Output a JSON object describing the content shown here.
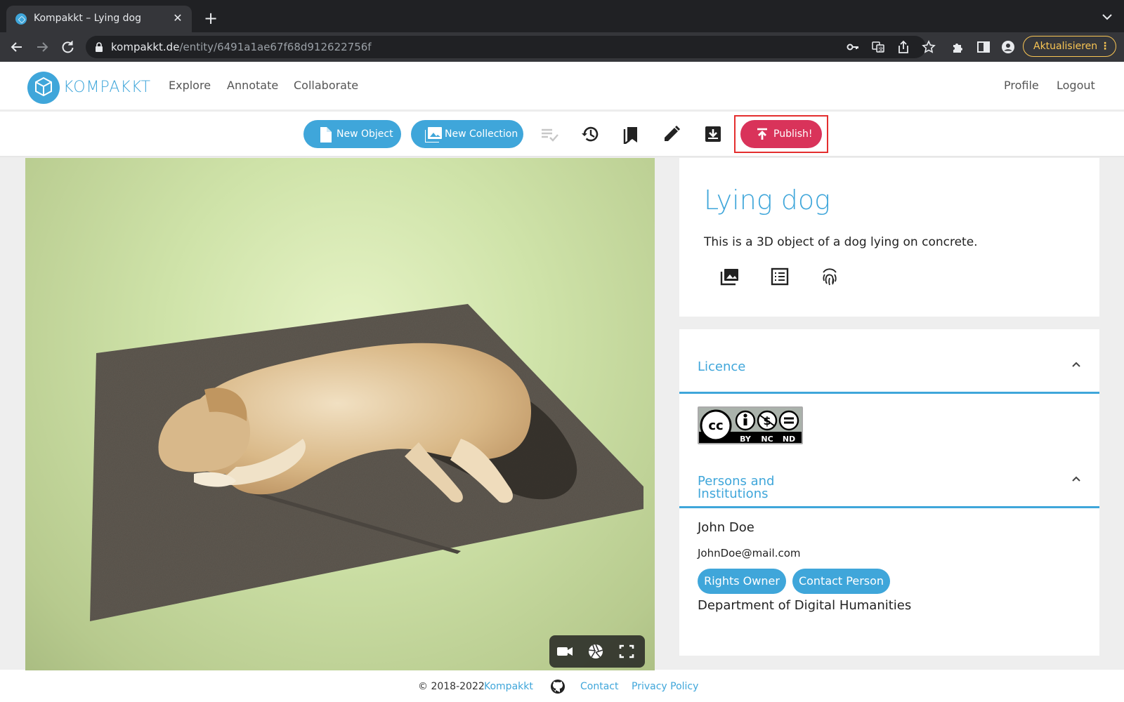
{
  "browser": {
    "tab_title": "Kompakkt – Lying dog",
    "close_glyph": "✕",
    "newtab_glyph": "+",
    "url_host": "kompakkt.de",
    "url_path": "/entity/6491a1ae67f68d912622756f",
    "update_label": "Aktualisieren",
    "menu_glyph": "⋮"
  },
  "header": {
    "logo_text": "KOMPAKKT",
    "nav": [
      "Explore",
      "Annotate",
      "Collaborate"
    ],
    "right_nav": [
      "Profile",
      "Logout"
    ]
  },
  "actions": {
    "new_object": "New Object",
    "new_collection": "New Collection",
    "publish": "Publish!",
    "icons": [
      "checklist-icon",
      "history-icon",
      "bookmark-icon",
      "edit-pencil-icon",
      "download-box-icon"
    ]
  },
  "object": {
    "title": "Lying dog",
    "description": "This is a 3D object of a dog lying on concrete.",
    "icons": [
      "image-gallery-icon",
      "metadata-list-icon",
      "fingerprint-icon"
    ]
  },
  "licence": {
    "heading": "Licence",
    "badge_cc": "cc",
    "badge_terms": [
      "BY",
      "NC",
      "ND"
    ]
  },
  "persons": {
    "heading_line1": "Persons and",
    "heading_line2": "Institutions",
    "name": "John Doe",
    "email": "JohnDoe@mail.com",
    "roles": [
      "Rights Owner",
      "Contact Person"
    ],
    "institution": "Department of Digital Humanities"
  },
  "viewer": {
    "controls": [
      "camera-icon",
      "aperture-icon",
      "fullscreen-icon"
    ]
  },
  "footer": {
    "copyright": "© 2018-2022",
    "brand_link": "Kompakkt",
    "contact": "Contact",
    "privacy": "Privacy Policy"
  },
  "colors": {
    "accent": "#3fa6da",
    "publish": "#d9335a",
    "highlight_frame": "#e42e2e",
    "update_button": "#f9c554"
  }
}
